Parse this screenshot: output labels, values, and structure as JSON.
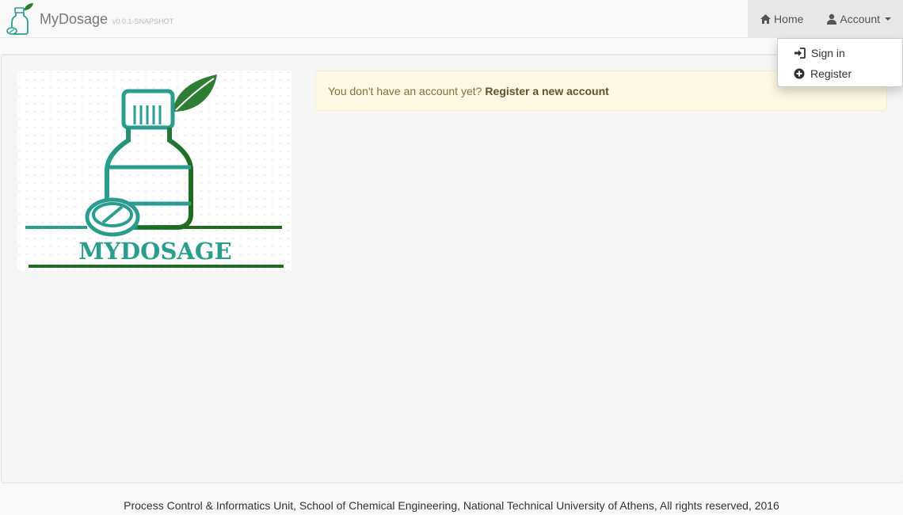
{
  "brand": {
    "name": "MyDosage",
    "version": "v0.0.1-SNAPSHOT"
  },
  "nav": {
    "home_label": "Home",
    "account_label": "Account",
    "account_menu": [
      {
        "label": "Sign in",
        "icon": "sign-in-icon"
      },
      {
        "label": "Register",
        "icon": "plus-circle-icon"
      }
    ]
  },
  "hero": {
    "logo_text": "MYDOSAGE"
  },
  "alert": {
    "text": "You don't have an account yet?",
    "link_label": "Register a new account"
  },
  "footer": {
    "text": "Process Control & Informatics Unit, School of Chemical Engineering, National Technical University of Athens, All rights reserved, 2016"
  },
  "colors": {
    "teal": "#2a9d8f",
    "dark_green": "#1f6b1f",
    "alert_bg": "#fcf8e3",
    "alert_text": "#8a6d3b"
  }
}
